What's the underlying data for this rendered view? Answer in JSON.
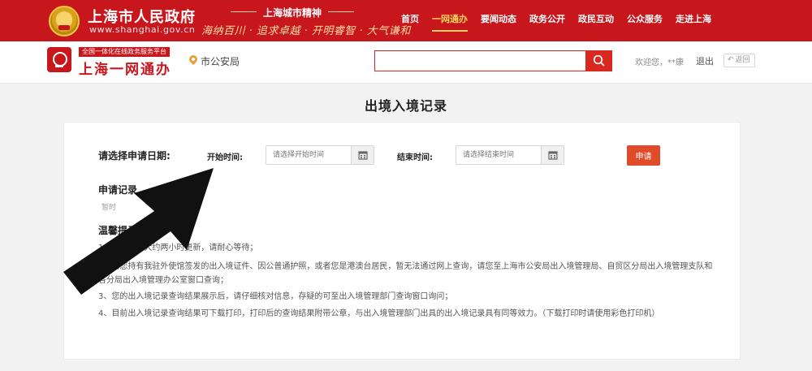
{
  "gov_header": {
    "title": "上海市人民政府",
    "url": "www.shanghai.gov.cn",
    "spirit_heading": "上海城市精神",
    "spirit_text": "海纳百川 · 追求卓越 · 开明睿智 · 大气谦和",
    "nav": [
      {
        "label": "首页"
      },
      {
        "label": "一网通办",
        "active": true
      },
      {
        "label": "要闻动态"
      },
      {
        "label": "政务公开"
      },
      {
        "label": "政民互动"
      },
      {
        "label": "公众服务"
      },
      {
        "label": "走进上海"
      }
    ]
  },
  "ywtb_header": {
    "badge": "全国一体化在线政务服务平台",
    "title": "上海一网通办",
    "location": "市公安局",
    "search_value": "",
    "welcome": "欢迎您，**康",
    "logout": "退出",
    "back": "返回"
  },
  "page": {
    "title": "出境入境记录",
    "apply_date_label": "请选择申请日期:",
    "start_label": "开始时间:",
    "start_placeholder": "请选择开始时间",
    "end_label": "结束时间:",
    "end_placeholder": "请选择结束时间",
    "apply_button": "申请",
    "records_title": "申请记录",
    "records_empty": "暂时",
    "tips_title": "温馨提示",
    "tips": [
      "1、查询结果大约两小时更新，请耐心等待；",
      "2、若您持有我驻外使馆签发的出入境证件、因公普通护照，或者您是港澳台居民，暂无法通过网上查询，请您至上海市公安局出入境管理局、自贸区分局出入境管理支队和各分局出入境管理办公室窗口查询；",
      "3、您的出入境记录查询结果展示后，请仔细核对信息，存疑的可至出入境管理部门查询窗口询问；",
      "4、目前出入境记录查询结果可下载打印，打印后的查询结果附带公章，与出入境管理部门出具的出入境记录具有同等效力。（下载打印时请使用彩色打印机）"
    ]
  },
  "colors": {
    "brand_red": "#c8161d",
    "nav_active": "#ffd45e",
    "button_orange": "#e04b2a"
  }
}
